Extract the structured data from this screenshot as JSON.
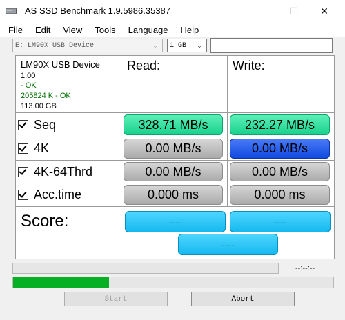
{
  "window": {
    "title": "AS SSD Benchmark 1.9.5986.35387",
    "icons": [
      "app-drive-icon",
      "minimize-icon",
      "maximize-icon",
      "close-icon"
    ],
    "minimize_glyph": "—",
    "maximize_glyph": "☐",
    "close_glyph": "✕"
  },
  "menu": {
    "items": [
      {
        "label": "File"
      },
      {
        "label": "Edit"
      },
      {
        "label": "View"
      },
      {
        "label": "Tools"
      },
      {
        "label": "Language"
      },
      {
        "label": "Help"
      }
    ]
  },
  "toolbar": {
    "drive_select_value": "E: LM90X USB Device",
    "size_select_value": "1 GB",
    "arrow_glyph": "⌵",
    "textbox_value": ""
  },
  "device": {
    "name": "LM90X USB Device",
    "version": "1.00",
    "status": " - OK",
    "alignment": "205824 K - OK",
    "capacity": "113.00 GB"
  },
  "headers": {
    "read": "Read:",
    "write": "Write:"
  },
  "rows": [
    {
      "label": "Seq",
      "read": "328.71 MB/s",
      "write": "232.27 MB/s",
      "read_style": "green",
      "write_style": "green"
    },
    {
      "label": "4K",
      "read": "0.00 MB/s",
      "write": "0.00 MB/s",
      "read_style": "gray",
      "write_style": "blue"
    },
    {
      "label": "4K-64Thrd",
      "read": "0.00 MB/s",
      "write": "0.00 MB/s",
      "read_style": "gray",
      "write_style": "gray"
    },
    {
      "label": "Acc.time",
      "read": "0.000 ms",
      "write": "0.000 ms",
      "read_style": "gray",
      "write_style": "gray"
    }
  ],
  "score": {
    "label": "Score:",
    "read": "----",
    "write": "----",
    "total": "----"
  },
  "status": {
    "timer": "--:--:--",
    "progress_fraction": 0.3
  },
  "buttons": {
    "start": "Start",
    "abort": "Abort"
  },
  "colors": {
    "green_result": "#16d08c",
    "blue_result": "#1048e0",
    "gray_result": "#a9a9a9",
    "score_result": "#14b8ef",
    "progress": "#06b025",
    "ok_text": "#007000"
  }
}
